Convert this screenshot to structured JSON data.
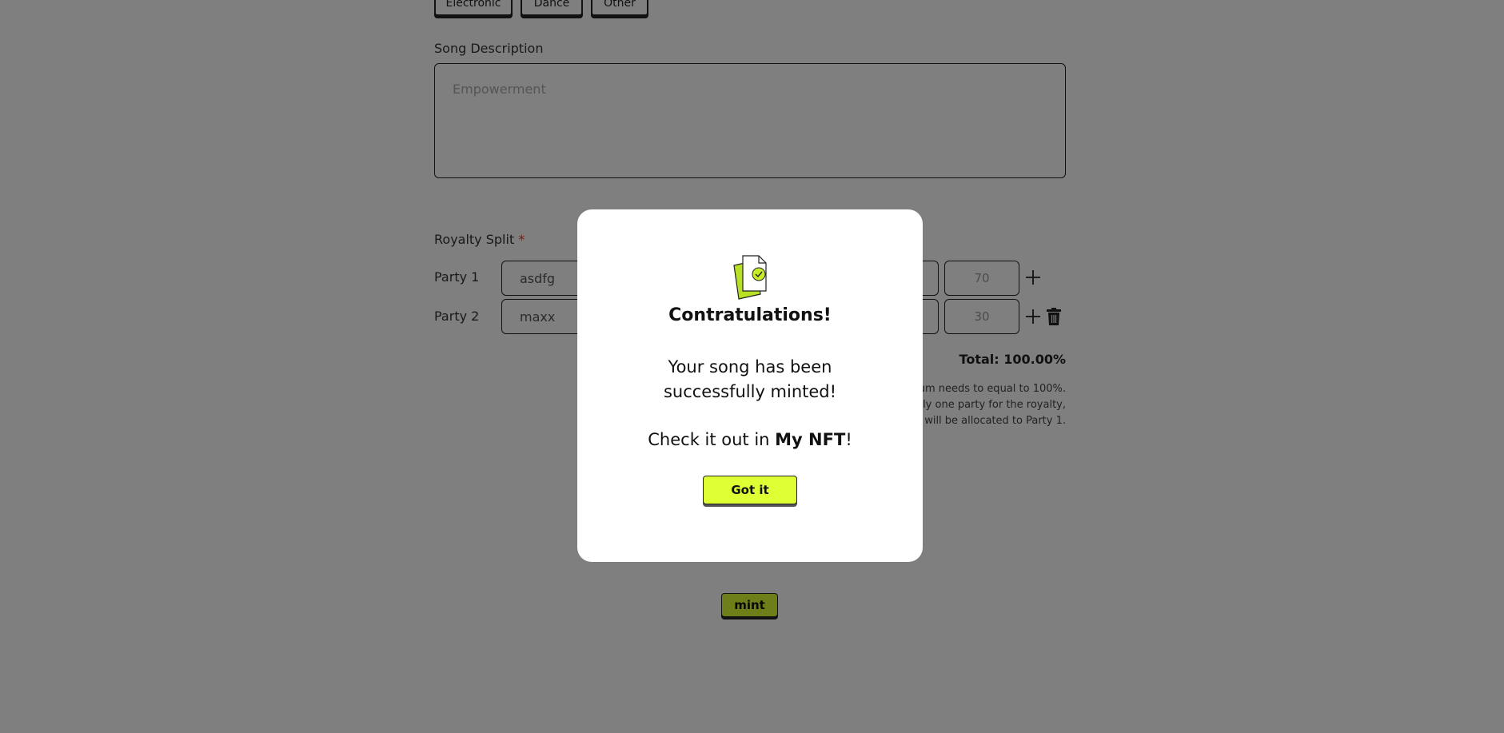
{
  "genres": [
    "Electronic",
    "Dance",
    "Other"
  ],
  "song_description": {
    "label": "Song Description",
    "placeholder": "Empowerment"
  },
  "royalty_split": {
    "label": "Royalty Split",
    "required_mark": "*",
    "parties": [
      {
        "label": "Party 1",
        "name": "asdfg",
        "percent": "70"
      },
      {
        "label": "Party 2",
        "name": "maxx",
        "percent": "30"
      }
    ],
    "total": "Total: 100.00%",
    "note_lines": [
      "um needs to equal to 100%.",
      "ly one party for the royalty,",
      "will be allocated to Party 1."
    ]
  },
  "mint_button": "mint",
  "modal": {
    "title": "Contratulations!",
    "message": "Your song has been successfully minted!",
    "check_prefix": "Check it out in ",
    "check_link": "My NFT",
    "check_suffix": "!",
    "button": "Got it"
  },
  "colors": {
    "accent": "#ddff33",
    "overlay": "rgba(0,0,0,0.5)",
    "required": "#e03a2f"
  },
  "icons": [
    "plus-icon",
    "trash-icon",
    "document-check-icon"
  ]
}
